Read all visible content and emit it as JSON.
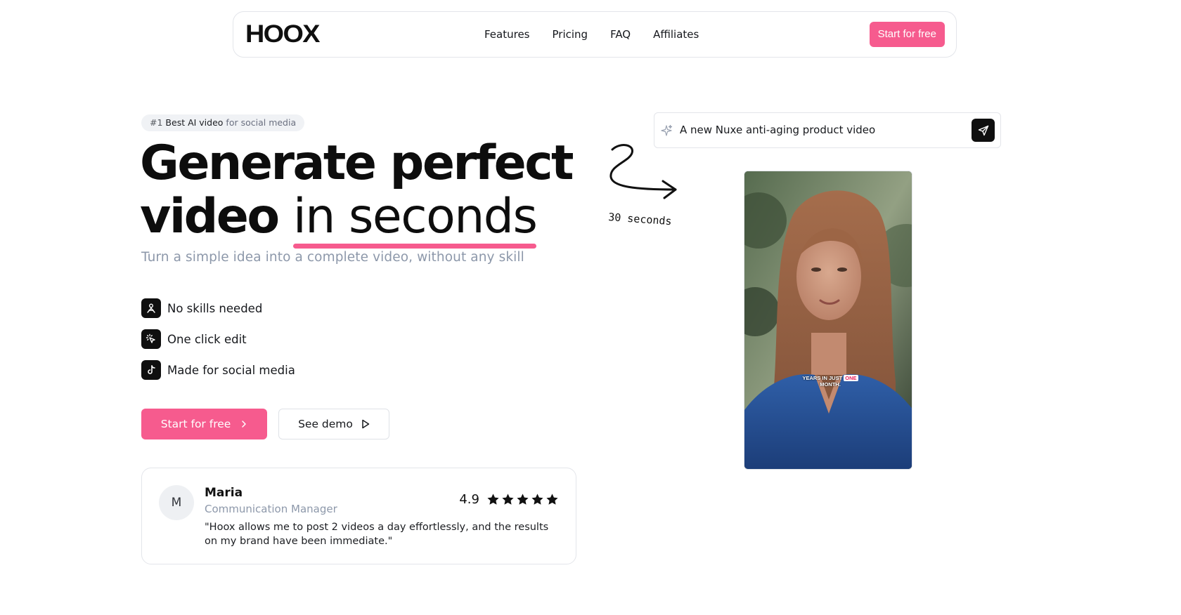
{
  "nav": {
    "logo": "HOOX",
    "links": [
      "Features",
      "Pricing",
      "FAQ",
      "Affiliates"
    ],
    "cta": "Start for free"
  },
  "hero": {
    "badge": {
      "rank": "#1",
      "highlight": "Best AI video",
      "suffix": "for social media"
    },
    "title_line1": "Generate perfect",
    "title_line2_bold": "video",
    "title_line2_light": "in seconds",
    "subtitle": "Turn a simple idea into a complete video, without any skill",
    "features": [
      {
        "label": "No skills needed",
        "icon": "person-icon"
      },
      {
        "label": "One click edit",
        "icon": "click-icon"
      },
      {
        "label": "Made for social media",
        "icon": "tiktok-icon"
      }
    ],
    "primary_button": "Start for free",
    "secondary_button": "See demo"
  },
  "testimonial": {
    "avatar_initial": "M",
    "name": "Maria",
    "role": "Communication Manager",
    "quote": "\"Hoox allows me to post 2 videos a day effortlessly, and the results on my brand have been immediate.\"",
    "rating": "4.9",
    "stars": 5
  },
  "prompt": {
    "text": "A new Nuxe anti-aging product video"
  },
  "doodle": {
    "label": "30 seconds"
  },
  "video": {
    "caption_text": "YEARS IN JUST",
    "caption_highlight": "ONE",
    "caption_end": "MONTH."
  },
  "colors": {
    "accent": "#f65b8e",
    "text": "#111111",
    "muted": "#8d98aa",
    "border": "#e3e5ea"
  }
}
